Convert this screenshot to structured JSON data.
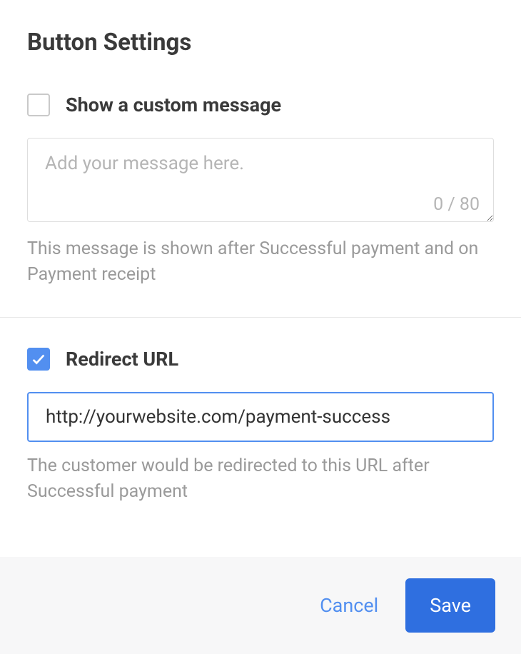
{
  "title": "Button Settings",
  "custom_message": {
    "checkbox_label": "Show a custom message",
    "checked": false,
    "value": "",
    "placeholder": "Add your message here.",
    "counter": "0 / 80",
    "helper": "This message is shown after Successful payment and on Payment receipt"
  },
  "redirect_url": {
    "checkbox_label": "Redirect URL",
    "checked": true,
    "value": "http://yourwebsite.com/payment-success",
    "helper": "The customer would be redirected to this URL after Successful payment"
  },
  "footer": {
    "cancel_label": "Cancel",
    "save_label": "Save"
  }
}
